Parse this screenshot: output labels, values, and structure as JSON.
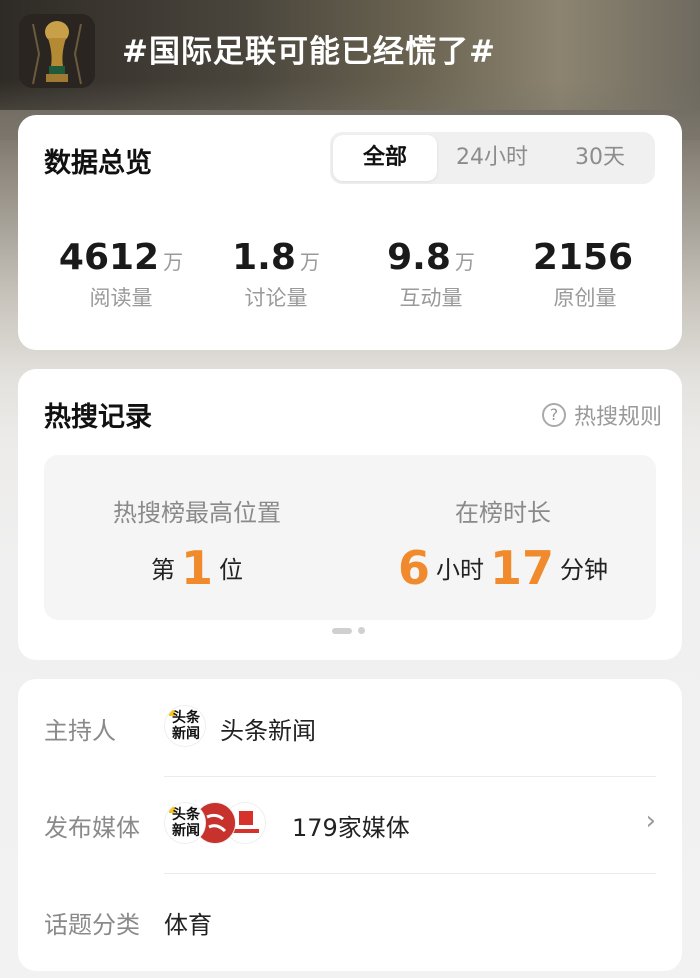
{
  "topic": {
    "title": "#国际足联可能已经慌了#",
    "thumbnail_icon": "trophy-icon"
  },
  "overview": {
    "title": "数据总览",
    "tabs": [
      {
        "label": "全部",
        "active": true
      },
      {
        "label": "24小时",
        "active": false
      },
      {
        "label": "30天",
        "active": false
      }
    ],
    "stats": [
      {
        "value": "4612",
        "unit": "万",
        "label": "阅读量"
      },
      {
        "value": "1.8",
        "unit": "万",
        "label": "讨论量"
      },
      {
        "value": "9.8",
        "unit": "万",
        "label": "互动量"
      },
      {
        "value": "2156",
        "unit": "",
        "label": "原创量"
      }
    ]
  },
  "hot_search": {
    "title": "热搜记录",
    "rules_label": "热搜规则",
    "peak_label": "热搜榜最高位置",
    "peak_prefix": "第",
    "peak_value": "1",
    "peak_suffix": "位",
    "duration_label": "在榜时长",
    "hours_value": "6",
    "hours_unit": "小时",
    "minutes_value": "17",
    "minutes_unit": "分钟",
    "accent_color": "#f08a2c"
  },
  "info": {
    "host_label": "主持人",
    "host_name": "头条新闻",
    "host_logo_text": "头条新闻",
    "media_label": "发布媒体",
    "media_count": "179家媒体",
    "category_label": "话题分类",
    "category_value": "体育"
  }
}
